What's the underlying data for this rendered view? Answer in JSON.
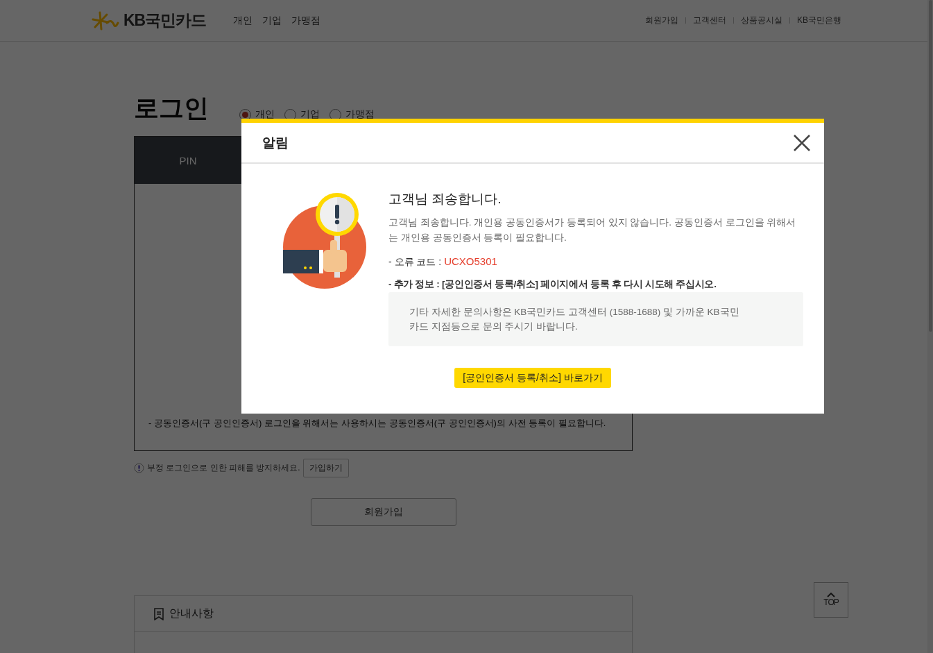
{
  "header": {
    "logo_text": "KB국민카드",
    "nav": [
      "개인",
      "기업",
      "가맹점"
    ],
    "util_links": [
      "회원가입",
      "고객센터",
      "상품공시실",
      "KB국민은행"
    ]
  },
  "login": {
    "title": "로그인",
    "member_types": [
      {
        "label": "개인",
        "selected": true
      },
      {
        "label": "기업",
        "selected": false
      },
      {
        "label": "가맹점",
        "selected": false
      }
    ],
    "tabs": [
      {
        "label": "PIN"
      }
    ],
    "note": "- 공동인증서(구 공인인증서) 로그인을 위해서는 사용하시는 공동인증서(구 공인인증서)의 사전 등록이 필요합니다.",
    "fraud_notice": "부정 로그인으로 인한 피해를 방지하세요.",
    "fraud_join_button": "가입하기",
    "signup_button": "회원가입"
  },
  "notice": {
    "title": "안내사항"
  },
  "top_button": "TOP",
  "dialog": {
    "title": "알림",
    "heading": "고객님 죄송합니다.",
    "message": "고객님 죄송합니다. 개인용 공동인증서가 등록되어 있지 않습니다. 공동인증서 로그인을 위해서는 개인용 공동인증서 등록이 필요합니다.",
    "error_label": "- 오류 코드 : ",
    "error_code": "UCXO5301",
    "extra_info": "- 추가 정보 : [공인인증서 등록/취소] 페이지에서 등록 후 다시 시도해 주십시오.",
    "contact": "기타 자세한 문의사항은 KB국민카드 고객센터 (1588-1688) 및 가까운 KB국민카드 지점등으로 문의 주시기 바랍니다.",
    "action_button": "[공인인증서 등록/취소] 바로가기"
  }
}
